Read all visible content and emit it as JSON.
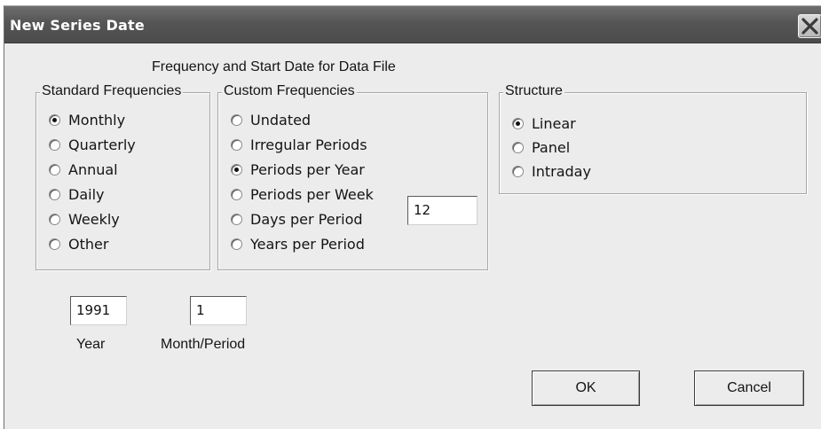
{
  "window": {
    "title": "New Series Date",
    "close_icon": "close-icon"
  },
  "heading": "Frequency and Start Date for Data File",
  "standard_frequencies": {
    "legend": "Standard Frequencies",
    "options": [
      "Monthly",
      "Quarterly",
      "Annual",
      "Daily",
      "Weekly",
      "Other"
    ],
    "selected": "Monthly"
  },
  "custom_frequencies": {
    "legend": "Custom Frequencies",
    "options": [
      "Undated",
      "Irregular Periods",
      "Periods per Year",
      "Periods per Week",
      "Days per Period",
      "Years per Period"
    ],
    "selected": "Periods per Year",
    "value": "12"
  },
  "structure": {
    "legend": "Structure",
    "options": [
      "Linear",
      "Panel",
      "Intraday"
    ],
    "selected": "Linear"
  },
  "start_date": {
    "year_value": "1991",
    "year_label": "Year",
    "period_value": "1",
    "period_label": "Month/Period"
  },
  "buttons": {
    "ok": "OK",
    "cancel": "Cancel"
  }
}
